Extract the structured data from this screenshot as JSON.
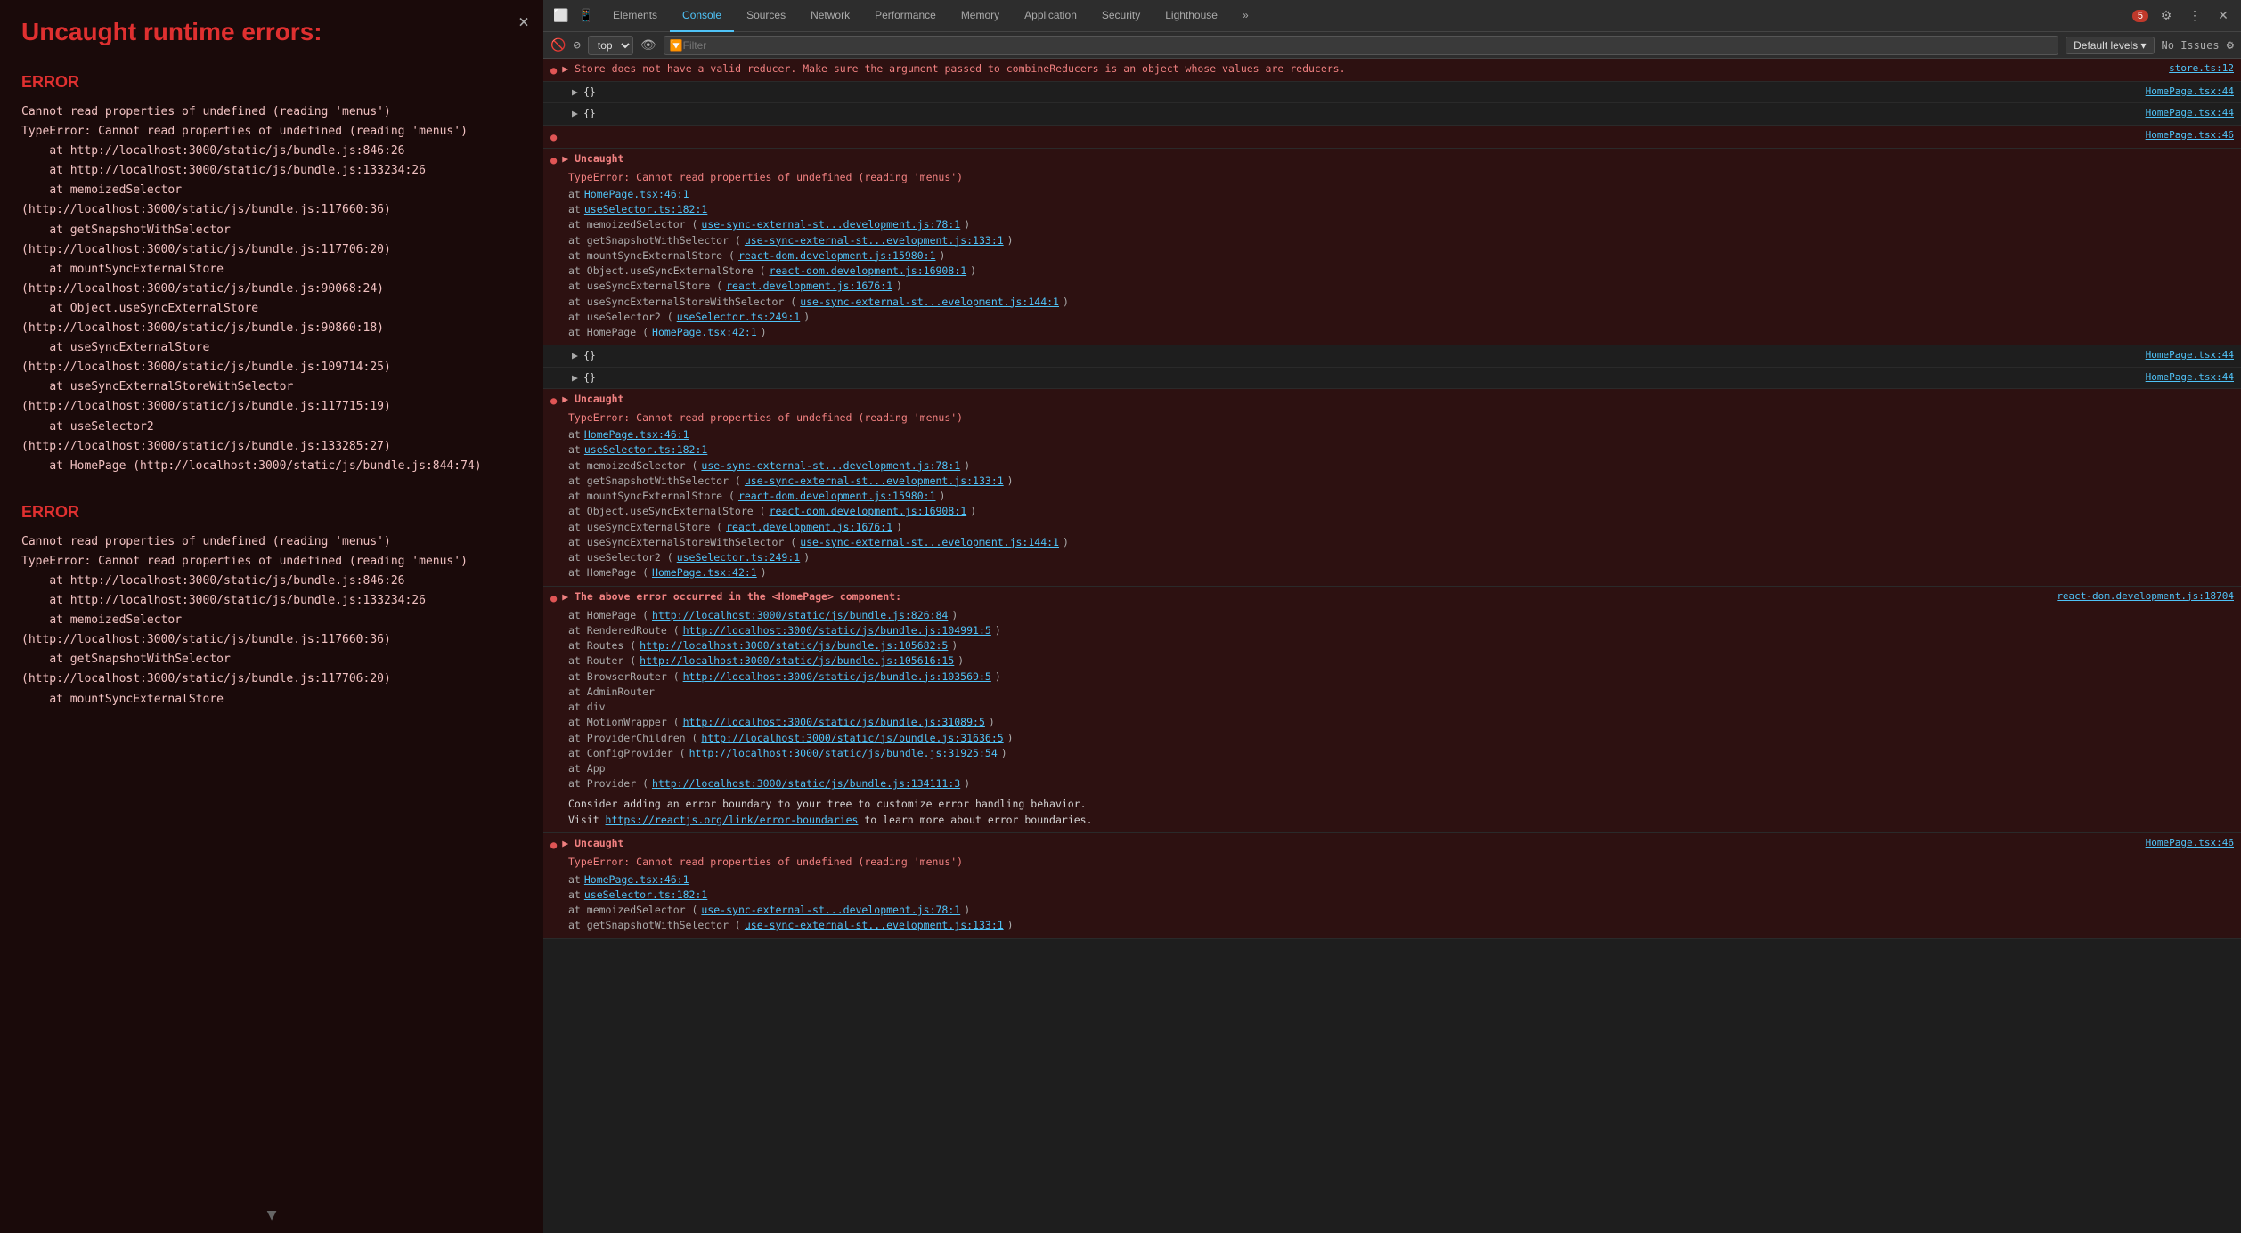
{
  "left_panel": {
    "title": "Uncaught runtime errors:",
    "close_label": "×",
    "errors": [
      {
        "label": "ERROR",
        "summary": "Cannot read properties of undefined (reading 'menus')",
        "detail": "TypeError: Cannot read properties of undefined (reading 'menus')\n    at http://localhost:3000/static/js/bundle.js:846:26\n    at http://localhost:3000/static/js/bundle.js:133234:26\n    at memoizedSelector\n(http://localhost:3000/static/js/bundle.js:117660:36)\n    at getSnapshotWithSelector\n(http://localhost:3000/static/js/bundle.js:117706:20)\n    at mountSyncExternalStore\n(http://localhost:3000/static/js/bundle.js:90068:24)\n    at Object.useSyncExternalStore\n(http://localhost:3000/static/js/bundle.js:90860:18)\n    at useSyncExternalStore\n(http://localhost:3000/static/js/bundle.js:109714:25)\n    at useSyncExternalStoreWithSelector\n(http://localhost:3000/static/js/bundle.js:117715:19)\n    at useSelector2\n(http://localhost:3000/static/js/bundle.js:133285:27)\n    at HomePage (http://localhost:3000/static/js/bundle.js:844:74)"
      },
      {
        "label": "ERROR",
        "summary": "Cannot read properties of undefined (reading 'menus')",
        "detail": "TypeError: Cannot read properties of undefined (reading 'menus')\n    at http://localhost:3000/static/js/bundle.js:846:26\n    at http://localhost:3000/static/js/bundle.js:133234:26\n    at memoizedSelector\n(http://localhost:3000/static/js/bundle.js:117660:36)\n    at getSnapshotWithSelector\n(http://localhost:3000/static/js/bundle.js:117706:20)\n    at mountSyncExternalStore\n(http://localhost:3000/static/js/bundle.js:90068:24)"
      }
    ]
  },
  "devtools": {
    "tabs": [
      {
        "label": "Elements",
        "active": false
      },
      {
        "label": "Console",
        "active": true
      },
      {
        "label": "Sources",
        "active": false
      },
      {
        "label": "Network",
        "active": false
      },
      {
        "label": "Performance",
        "active": false
      },
      {
        "label": "Memory",
        "active": false
      },
      {
        "label": "Application",
        "active": false
      },
      {
        "label": "Security",
        "active": false
      },
      {
        "label": "Lighthouse",
        "active": false
      }
    ],
    "error_count": "5",
    "context_selector": "top",
    "filter_placeholder": "Filter",
    "default_levels": "Default levels",
    "no_issues": "No Issues"
  },
  "console_entries": [
    {
      "type": "error",
      "icon": "●",
      "expand": "▶",
      "text": "▶ Store does not have a valid reducer. Make sure the argument passed to combineReducers is an object whose values are reducers.",
      "location": "store.ts:12"
    },
    {
      "type": "obj",
      "content": "▶ {}",
      "location": "HomePage.tsx:44"
    },
    {
      "type": "obj",
      "content": "▶ {}",
      "location": "HomePage.tsx:44"
    },
    {
      "type": "obj",
      "location": "HomePage.tsx:46"
    },
    {
      "type": "uncaught",
      "header": "▶ Uncaught",
      "typeError": "TypeError: Cannot read properties of undefined (reading 'menus')",
      "stack": [
        {
          "at": "at",
          "fn": "HomePage.tsx:46:1",
          "link": "HomePage.tsx:46:1"
        },
        {
          "at": "at",
          "fn": "useSelector.ts:182:1",
          "link": "useSelector.ts:182:1"
        },
        {
          "at": "at memoizedSelector (",
          "fn": "use-sync-external-st...development.js:78:1",
          "link": "use-sync-external-st...development.js:78:1",
          "suffix": ")"
        },
        {
          "at": "at getSnapshotWithSelector (",
          "fn": "use-sync-external-st...evelopment.js:133:1",
          "link": "use-sync-external-st...evelopment.js:133:1",
          "suffix": ")"
        },
        {
          "at": "at mountSyncExternalStore (",
          "fn": "react-dom.development.js:15980:1",
          "link": "react-dom.development.js:15980:1",
          "suffix": ")"
        },
        {
          "at": "at Object.useSyncExternalStore (",
          "fn": "react-dom.development.js:16908:1",
          "link": "react-dom.development.js:16908:1",
          "suffix": ")"
        },
        {
          "at": "at useSyncExternalStore (",
          "fn": "react.development.js:1676:1",
          "link": "react.development.js:1676:1",
          "suffix": ")"
        },
        {
          "at": "at useSyncExternalStoreWithSelector (",
          "fn": "use-sync-external-st...evelopment.js:144:1",
          "link": "use-sync-external-st...evelopment.js:144:1",
          "suffix": ")"
        },
        {
          "at": "at useSelector2 (",
          "fn": "useSelector.ts:249:1",
          "link": "useSelector.ts:249:1",
          "suffix": ")"
        },
        {
          "at": "at HomePage (",
          "fn": "HomePage.tsx:42:1",
          "link": "HomePage.tsx:42:1",
          "suffix": ")"
        }
      ]
    },
    {
      "type": "obj",
      "content": "▶ {}",
      "location": "HomePage.tsx:44"
    },
    {
      "type": "obj",
      "content": "▶ {}",
      "location": "HomePage.tsx:44"
    },
    {
      "type": "uncaught2",
      "header": "▶ Uncaught",
      "typeError": "TypeError: Cannot read properties of undefined (reading 'menus')",
      "stack": [
        {
          "at": "at",
          "fn": "HomePage.tsx:46:1",
          "link": "HomePage.tsx:46:1"
        },
        {
          "at": "at",
          "fn": "useSelector.ts:182:1",
          "link": "useSelector.ts:182:1"
        },
        {
          "at": "at memoizedSelector (",
          "fn": "use-sync-external-st...development.js:78:1",
          "link": "use-sync-external-st...development.js:78:1",
          "suffix": ")"
        },
        {
          "at": "at getSnapshotWithSelector (",
          "fn": "use-sync-external-st...evelopment.js:133:1",
          "link": "use-sync-external-st...evelopment.js:133:1",
          "suffix": ")"
        },
        {
          "at": "at mountSyncExternalStore (",
          "fn": "react-dom.development.js:15980:1",
          "link": "react-dom.development.js:15980:1",
          "suffix": ")"
        },
        {
          "at": "at Object.useSyncExternalStore (",
          "fn": "react-dom.development.js:16908:1",
          "link": "react-dom.development.js:16908:1",
          "suffix": ")"
        },
        {
          "at": "at useSyncExternalStore (",
          "fn": "react.development.js:1676:1",
          "link": "react.development.js:1676:1",
          "suffix": ")"
        },
        {
          "at": "at useSyncExternalStoreWithSelector (",
          "fn": "use-sync-external-st...evelopment.js:144:1",
          "link": "use-sync-external-st...evelopment.js:144:1",
          "suffix": ")"
        },
        {
          "at": "at useSelector2 (",
          "fn": "useSelector.ts:249:1",
          "link": "useSelector.ts:249:1",
          "suffix": ")"
        },
        {
          "at": "at HomePage (",
          "fn": "HomePage.tsx:42:1",
          "link": "HomePage.tsx:42:1",
          "suffix": ")"
        }
      ]
    },
    {
      "type": "above-error",
      "header": "▶ The above error occurred in the <HomePage> component:",
      "location": "react-dom.development.js:18704",
      "stack": [
        {
          "at": "at HomePage (",
          "fn": "http://localhost:3000/static/js/bundle.js:826:84",
          "link": "http://localhost:3000/static/js/bundle.js:826:84",
          "suffix": ")"
        },
        {
          "at": "at RenderedRoute (",
          "fn": "http://localhost:3000/static/js/bundle.js:104991:5",
          "link": "http://localhost:3000/static/js/bundle.js:104991:5",
          "suffix": ")"
        },
        {
          "at": "at Routes (",
          "fn": "http://localhost:3000/static/js/bundle.js:105682:5",
          "link": "http://localhost:3000/static/js/bundle.js:105682:5",
          "suffix": ")"
        },
        {
          "at": "at Router (",
          "fn": "http://localhost:3000/static/js/bundle.js:105616:15",
          "link": "http://localhost:3000/static/js/bundle.js:105616:15",
          "suffix": ")"
        },
        {
          "at": "at BrowserRouter (",
          "fn": "http://localhost:3000/static/js/bundle.js:103569:5",
          "link": "http://localhost:3000/static/js/bundle.js:103569:5",
          "suffix": ")"
        },
        {
          "at": "at AdminRouter",
          "fn": "",
          "link": ""
        },
        {
          "at": "at div",
          "fn": "",
          "link": ""
        },
        {
          "at": "at MotionWrapper (",
          "fn": "http://localhost:3000/static/js/bundle.js:31089:5",
          "link": "http://localhost:3000/static/js/bundle.js:31089:5",
          "suffix": ")"
        },
        {
          "at": "at ProviderChildren (",
          "fn": "http://localhost:3000/static/js/bundle.js:31636:5",
          "link": "http://localhost:3000/static/js/bundle.js:31636:5",
          "suffix": ")"
        },
        {
          "at": "at ConfigProvider (",
          "fn": "http://localhost:3000/static/js/bundle.js:31925:54",
          "link": "http://localhost:3000/static/js/bundle.js:31925:54",
          "suffix": ")"
        },
        {
          "at": "at App",
          "fn": "",
          "link": ""
        },
        {
          "at": "at Provider (",
          "fn": "http://localhost:3000/static/js/bundle.js:134111:3",
          "link": "http://localhost:3000/static/js/bundle.js:134111:3",
          "suffix": ")"
        }
      ],
      "consider": "Consider adding an error boundary to your tree to customize error handling behavior.\nVisit https://reactjs.org/link/error-boundaries to learn more about error boundaries.",
      "boundary_link": "https://reactjs.org/link/error-boundaries"
    },
    {
      "type": "uncaught3",
      "header": "▶ Uncaught",
      "typeError": "TypeError: Cannot read properties of undefined (reading 'menus')",
      "location": "HomePage.tsx:46",
      "stack": [
        {
          "at": "at",
          "fn": "HomePage.tsx:46:1",
          "link": "HomePage.tsx:46:1"
        },
        {
          "at": "at",
          "fn": "useSelector.ts:182:1",
          "link": "useSelector.ts:182:1"
        },
        {
          "at": "at memoizedSelector (",
          "fn": "use-sync-external-st...development.js:78:1",
          "link": "use-sync-external-st...development.js:78:1",
          "suffix": ")"
        },
        {
          "at": "at getSnapshotWithSelector (",
          "fn": "use-sync-external-st...evelopment.js:133:1",
          "link": "use-sync-external-st...evelopment.js:133:1",
          "suffix": ")"
        }
      ]
    }
  ]
}
